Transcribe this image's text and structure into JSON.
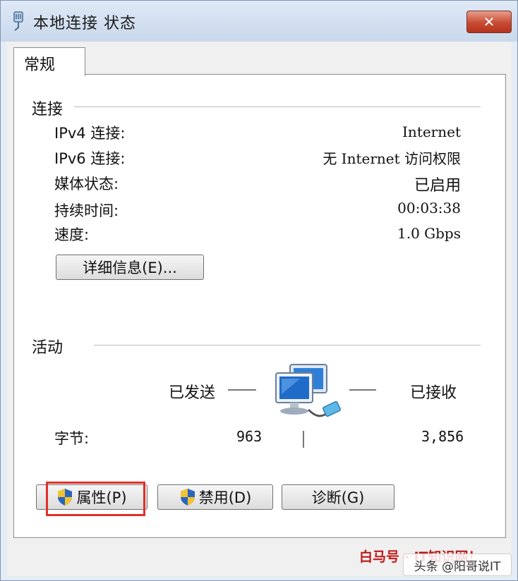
{
  "window": {
    "title": "本地连接 状态",
    "close_symbol": "✕",
    "title_icon": "network-adapter-icon"
  },
  "tabs": [
    {
      "label": "常规",
      "selected": true
    }
  ],
  "connection": {
    "heading": "连接",
    "rows": [
      {
        "label": "IPv4 连接:",
        "value": "Internet"
      },
      {
        "label": "IPv6 连接:",
        "value": "无 Internet 访问权限"
      },
      {
        "label": "媒体状态:",
        "value": "已启用"
      },
      {
        "label": "持续时间:",
        "value": "00:03:38"
      },
      {
        "label": "速度:",
        "value": "1.0 Gbps"
      }
    ],
    "details_button": "详细信息(E)..."
  },
  "activity": {
    "heading": "活动",
    "sent_label": "已发送",
    "received_label": "已接收",
    "bytes_label": "字节:",
    "bytes_sent": "963",
    "bytes_received": "3,856",
    "icon": "network-computers-icon"
  },
  "buttons": {
    "properties": "属性(P)",
    "disable": "禁用(D)",
    "diagnose": "诊断(G)"
  },
  "overlay": {
    "watermark": "白马号 · IT知识网！",
    "byline": "头条 @阳哥说IT"
  },
  "colors": {
    "highlight_box": "#e0302a",
    "close_button": "#c94b33"
  }
}
